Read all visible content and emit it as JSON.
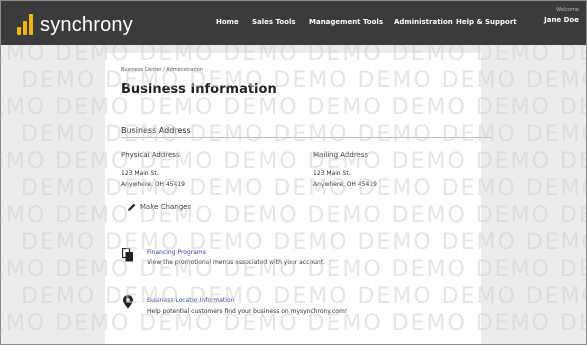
{
  "header": {
    "logo_text": "synchrony",
    "nav": [
      {
        "label": "Home"
      },
      {
        "label": "Sales Tools"
      },
      {
        "label": "Management Tools"
      },
      {
        "label": "Administration"
      },
      {
        "label": "Help & Support"
      }
    ],
    "welcome_label": "Welcome",
    "user_name": "Jane Doe"
  },
  "watermark_text": "DEMO",
  "breadcrumb": "Business Center / Administration",
  "page_title": "Business Information",
  "business_address": {
    "section_title": "Business Address",
    "physical": {
      "heading": "Physical Address",
      "line1": "123 Main St.",
      "line2": "Anywhere, OH 45419"
    },
    "mailing": {
      "heading": "Mailing Address",
      "line1": "123 Main St.",
      "line2": "Anywhere, OH 45419"
    },
    "make_changes_label": "Make Changes"
  },
  "features": [
    {
      "icon": "financing-programs-icon",
      "title": "Financing Programs",
      "description": "View the promotional menus associated with your account."
    },
    {
      "icon": "location-pin-icon",
      "title": "Business Locator Information",
      "description": "Help potential customers find your business on mysynchrony.com!"
    }
  ],
  "colors": {
    "header_bg": "#3a3b3c",
    "brand_yellow": "#f7b500",
    "link_blue": "#2a4a9a"
  }
}
